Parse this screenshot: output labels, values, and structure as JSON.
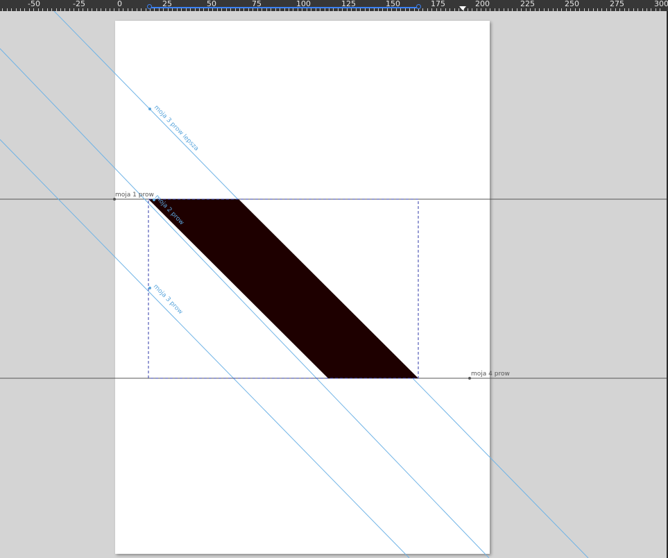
{
  "ruler": {
    "labels": [
      "-50",
      "-25",
      "0",
      "25",
      "50",
      "75",
      "100",
      "125",
      "150",
      "175",
      "200",
      "225",
      "250",
      "275",
      "300"
    ],
    "label_values": [
      -50,
      -25,
      0,
      25,
      50,
      75,
      100,
      125,
      150,
      175,
      200,
      225,
      250,
      275,
      300
    ],
    "unit": "mm"
  },
  "guides": {
    "moja_1_prow": "moja 1 prow",
    "moja_2_prow": "moja 2 prow",
    "moja_3_prow": "moja 3 prow",
    "moja_3_prow_lepsza": "moja 3 prow lepsza",
    "moja_4_prow": "moja 4 prow"
  },
  "colors": {
    "workspace": "#d4d4d4",
    "page": "#ffffff",
    "shape_fill": "#1e0000",
    "guide_line": "#6fb3e6",
    "guide_label": "#5aa5dc",
    "horizontal_guide": "#555555",
    "selection": "#2f3aa8",
    "ruler_bg": "#373737",
    "ruler_highlight": "#3b82f6"
  }
}
